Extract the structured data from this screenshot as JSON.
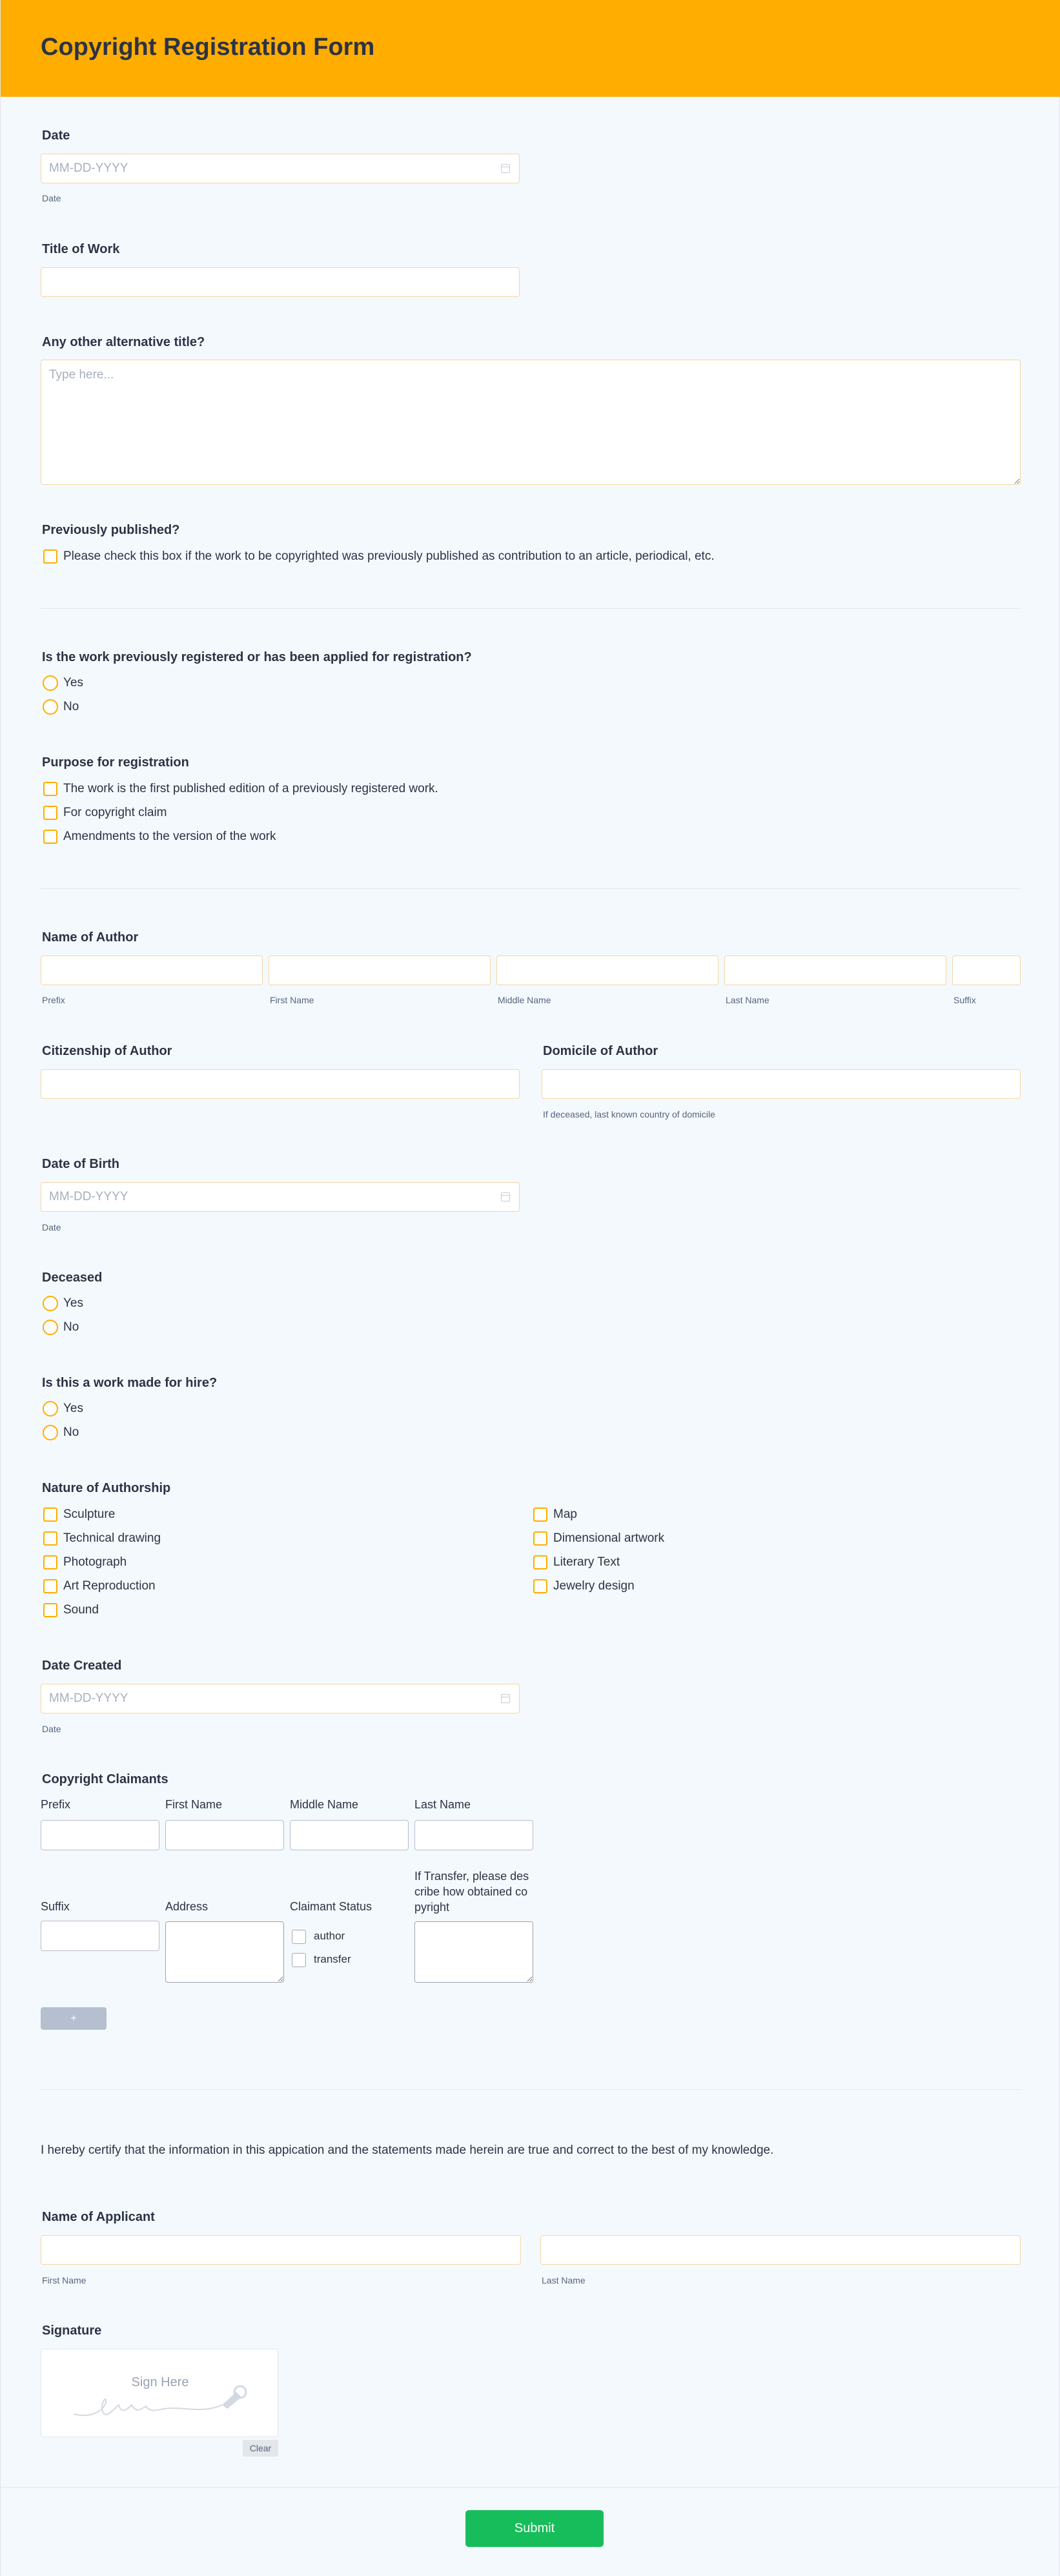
{
  "form": {
    "title": "Copyright Registration Form",
    "date": {
      "label": "Date",
      "placeholder": "MM-DD-YYYY",
      "sublabel": "Date"
    },
    "title_of_work": {
      "label": "Title of Work"
    },
    "alt_title": {
      "label": "Any other alternative title?",
      "placeholder": "Type here..."
    },
    "prev_published": {
      "label": "Previously published?",
      "option": "Please check this box if the work to be copyrighted was previously published as contribution to an article, periodical, etc."
    },
    "prev_registered": {
      "label": "Is the work previously registered or has been applied for registration?",
      "options": [
        "Yes",
        "No"
      ]
    },
    "purpose": {
      "label": "Purpose for registration",
      "options": [
        "The work is the first published edition of a previously registered work.",
        "For copyright claim",
        "Amendments to the version of the work"
      ]
    },
    "author_name": {
      "label": "Name of Author",
      "sublabels": [
        "Prefix",
        "First Name",
        "Middle Name",
        "Last Name",
        "Suffix"
      ]
    },
    "citizenship": {
      "label": "Citizenship of Author"
    },
    "domicile": {
      "label": "Domicile of Author",
      "sublabel": "If deceased, last known country of domicile"
    },
    "dob": {
      "label": "Date of Birth",
      "placeholder": "MM-DD-YYYY",
      "sublabel": "Date"
    },
    "deceased": {
      "label": "Deceased",
      "options": [
        "Yes",
        "No"
      ]
    },
    "hire": {
      "label": "Is this a work made for hire?",
      "options": [
        "Yes",
        "No"
      ]
    },
    "nature": {
      "label": "Nature of Authorship",
      "col1": [
        "Sculpture",
        "Technical drawing",
        "Photograph",
        "Art Reproduction",
        "Sound"
      ],
      "col2": [
        "Map",
        "Dimensional artwork",
        "Literary Text",
        "Jewelry design"
      ]
    },
    "date_created": {
      "label": "Date Created",
      "placeholder": "MM-DD-YYYY",
      "sublabel": "Date"
    },
    "claimants": {
      "label": "Copyright Claimants",
      "cols_row1": [
        "Prefix",
        "First Name",
        "Middle Name",
        "Last Name"
      ],
      "cols_row2": [
        "Suffix",
        "Address",
        "Claimant Status",
        "If Transfer, please describe how obtained copyright"
      ],
      "status_options": [
        "author",
        "transfer"
      ],
      "add_label": "+"
    },
    "certify": "I hereby certify that the information in this appication and the statements made herein are true and correct to the best of my knowledge.",
    "applicant": {
      "label": "Name of Applicant",
      "sublabels": [
        "First Name",
        "Last Name"
      ]
    },
    "signature": {
      "label": "Signature",
      "placeholder": "Sign Here",
      "clear": "Clear"
    },
    "submit": "Submit"
  }
}
